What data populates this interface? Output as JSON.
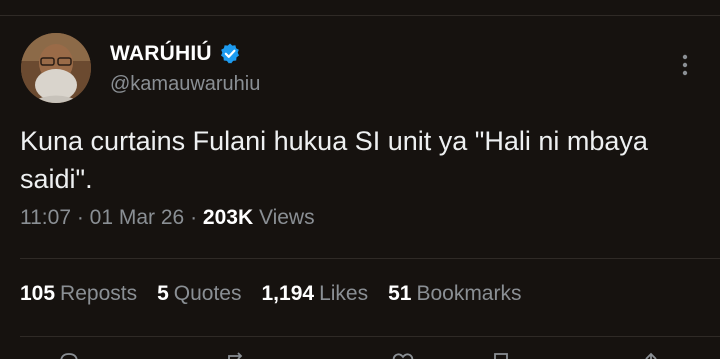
{
  "author": {
    "display_name": "WARÚHIÚ",
    "handle": "@kamauwaruhiu",
    "verified": true,
    "avatar_icon": "avatar-photo"
  },
  "tweet": {
    "text": "Kuna curtains Fulani hukua SI unit ya \"Hali ni mbaya saidi\"."
  },
  "meta": {
    "time": "11:07",
    "separator": "·",
    "date": "01 Mar 26",
    "views_count": "203K",
    "views_label": "Views"
  },
  "stats": [
    {
      "count": "105",
      "label": "Reposts"
    },
    {
      "count": "5",
      "label": "Quotes"
    },
    {
      "count": "1,194",
      "label": "Likes"
    },
    {
      "count": "51",
      "label": "Bookmarks"
    }
  ],
  "colors": {
    "background": "#16120f",
    "text": "#eef0f1",
    "muted": "#8a8f94",
    "verified": "#1d9bf0",
    "divider": "#2f2a26"
  }
}
